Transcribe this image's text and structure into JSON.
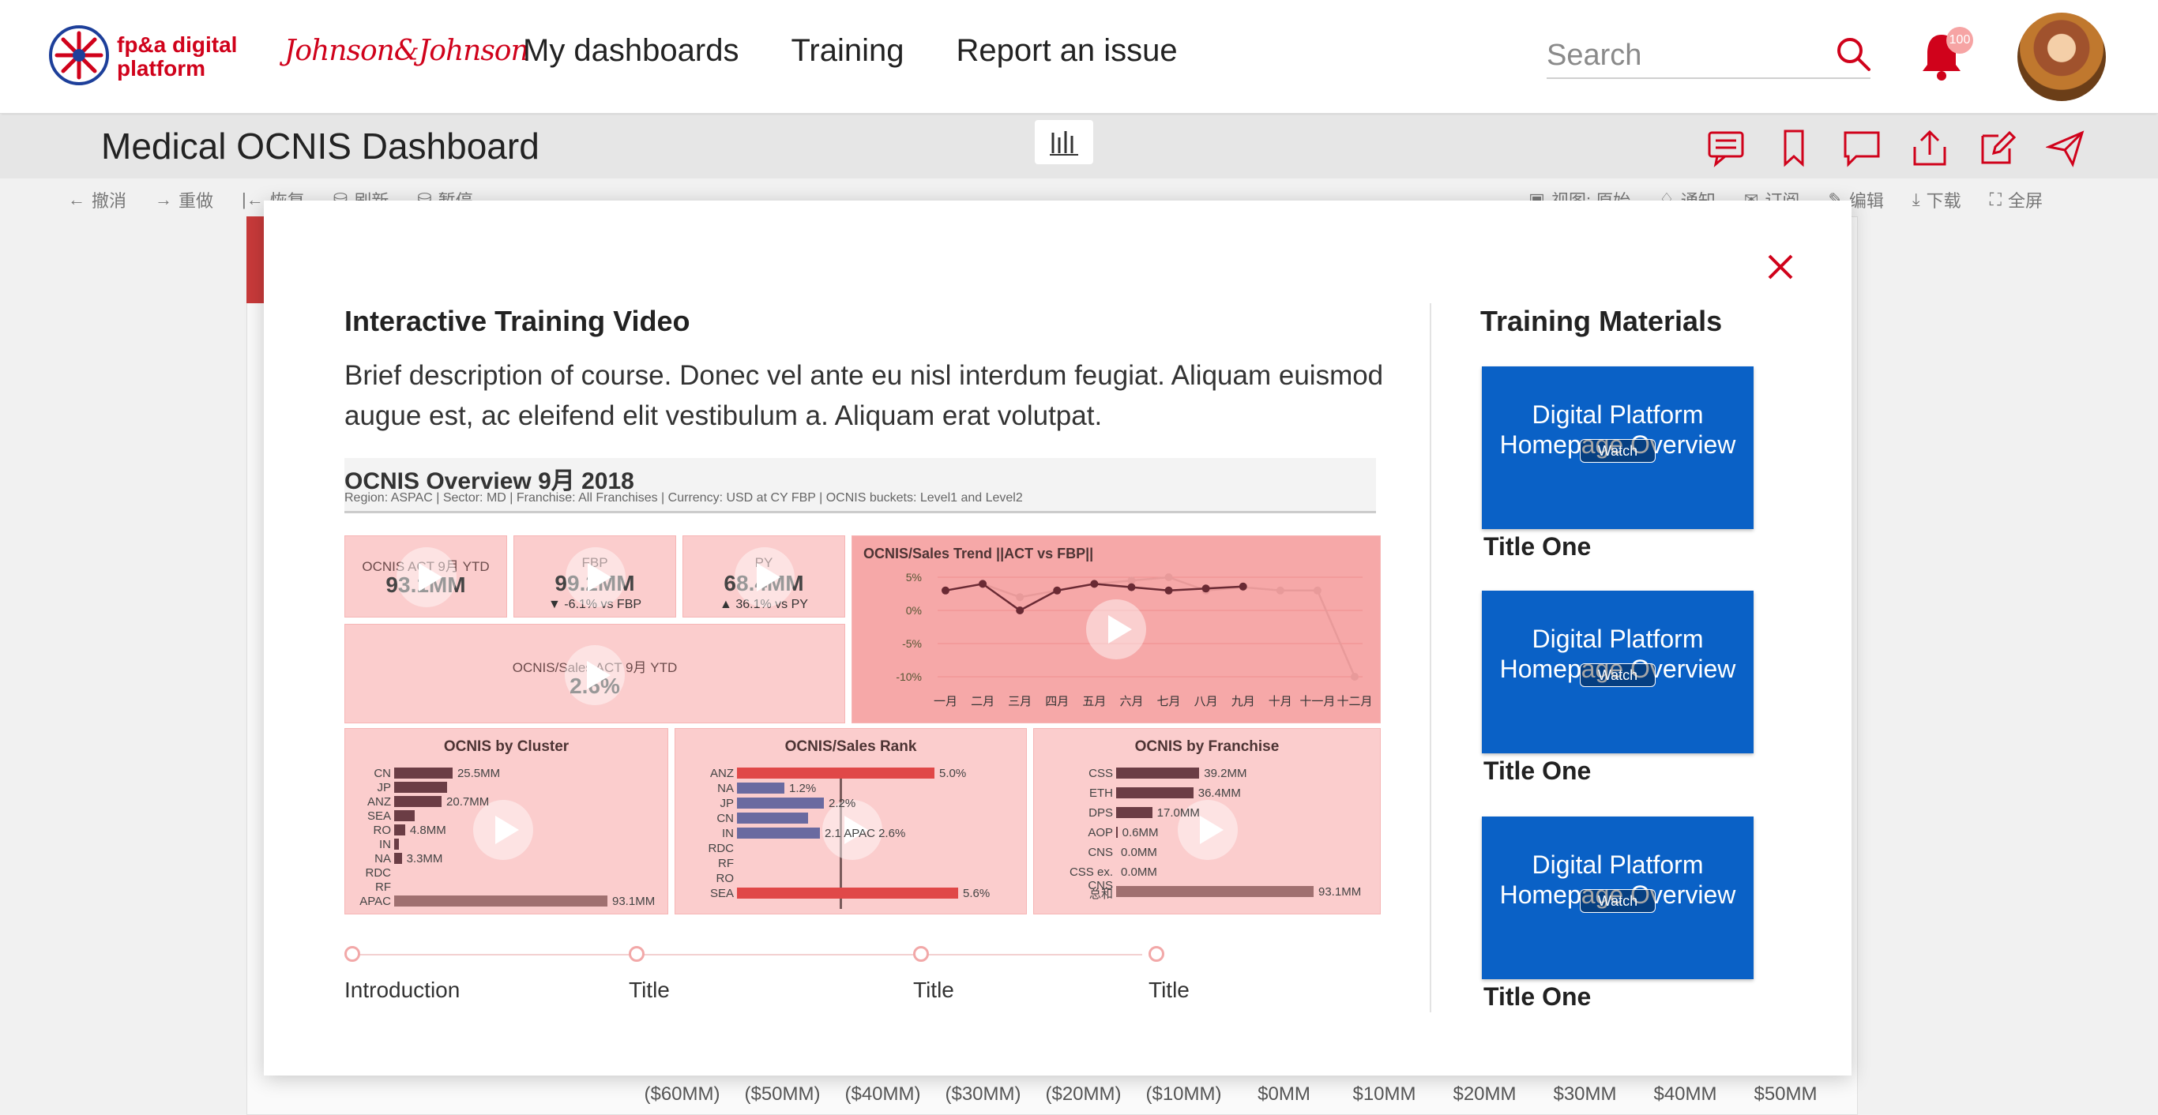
{
  "brand": {
    "name": "fp&a digital platform",
    "partner": "Johnson&Johnson"
  },
  "nav": {
    "links": [
      "My dashboards",
      "Training",
      "Report an issue"
    ]
  },
  "search": {
    "placeholder": "Search"
  },
  "notifications": {
    "count": "100"
  },
  "subheader": {
    "title": "Medical OCNIS Dashboard"
  },
  "toolbar": {
    "left": [
      "撤消",
      "重做",
      "恢复",
      "刷新",
      "暂停"
    ],
    "right": [
      "视图: 原始",
      "通知",
      "订阅",
      "编辑",
      "下载",
      "全屏"
    ]
  },
  "background": {
    "axis_labels": [
      "($60MM)",
      "($50MM)",
      "($40MM)",
      "($30MM)",
      "($20MM)",
      "($10MM)",
      "$0MM",
      "$10MM",
      "$20MM",
      "$30MM",
      "$40MM",
      "$50MM"
    ]
  },
  "modal": {
    "video_title": "Interactive Training Video",
    "description": "Brief description of course. Donec vel ante eu nisl interdum feugiat. Aliquam euismod augue est, ac eleifend elit vestibulum a. Aliquam erat volutpat.",
    "materials_title": "Training Materials",
    "timeline": [
      "Introduction",
      "Title",
      "Title",
      "Title"
    ],
    "materials": [
      {
        "thumb_text": "Digital Platform Homepage Overview",
        "watch": "Watch",
        "caption": "Title One"
      },
      {
        "thumb_text": "Digital Platform Homepage Overview",
        "watch": "Watch",
        "caption": "Title One"
      },
      {
        "thumb_text": "Digital Platform Homepage Overview",
        "watch": "Watch",
        "caption": "Title One"
      }
    ]
  },
  "video_preview": {
    "title": "OCNIS Overview 9月 2018",
    "subtitle": "Region: ASPAC | Sector: MD | Franchise: All Franchises | Currency: USD at CY FBP | OCNIS buckets: Level1 and Level2",
    "kpi": {
      "act_label": "OCNIS ACT 9月 YTD",
      "act_value": "93.1MM",
      "fbp_label": "FBP",
      "fbp_value": "99.2MM",
      "fbp_delta": "▼ -6.1% vs FBP",
      "py_label": "PY",
      "py_value": "68.4MM",
      "py_delta": "▲ 36.1% vs PY",
      "ratio_label": "OCNIS/Sales ACT 9月 YTD",
      "ratio_value": "2.6%"
    },
    "trend": {
      "title": "OCNIS/Sales Trend ||ACT vs FBP||",
      "months": [
        "一月",
        "二月",
        "三月",
        "四月",
        "五月",
        "六月",
        "七月",
        "八月",
        "九月",
        "十月",
        "十一月",
        "十二月"
      ],
      "act": [
        3,
        4,
        0,
        3,
        4,
        3.5,
        3,
        3.3,
        3.6
      ],
      "fbp": [
        3,
        4,
        2,
        3,
        4,
        4.5,
        5,
        3,
        3.5,
        3,
        3,
        -10
      ],
      "ylabels": [
        "5%",
        "0%",
        "-5%",
        "-10%"
      ]
    },
    "cluster": {
      "title": "OCNIS by Cluster",
      "rows": [
        {
          "cat": "CN",
          "value": 25.5,
          "label": "25.5MM"
        },
        {
          "cat": "JP",
          "value": 23,
          "label": ""
        },
        {
          "cat": "ANZ",
          "value": 20.7,
          "label": "20.7MM"
        },
        {
          "cat": "SEA",
          "value": 9,
          "label": ""
        },
        {
          "cat": "RO",
          "value": 4.8,
          "label": "4.8MM"
        },
        {
          "cat": "IN",
          "value": 2,
          "label": ""
        },
        {
          "cat": "NA",
          "value": 3.3,
          "label": "3.3MM"
        },
        {
          "cat": "RDC",
          "value": 0,
          "label": ""
        },
        {
          "cat": "RF",
          "value": 0,
          "label": ""
        },
        {
          "cat": "APAC",
          "value": 93.1,
          "label": "93.1MM"
        }
      ]
    },
    "rank": {
      "title": "OCNIS/Sales Rank",
      "rows": [
        {
          "cat": "ANZ",
          "value": 5.0,
          "label": "5.0%"
        },
        {
          "cat": "NA",
          "value": 1.2,
          "label": "1.2%"
        },
        {
          "cat": "JP",
          "value": 2.2,
          "label": "2.2%"
        },
        {
          "cat": "CN",
          "value": 1.8,
          "label": ""
        },
        {
          "cat": "IN",
          "value": 2.1,
          "label": "2.1 APAC 2.6%"
        },
        {
          "cat": "RDC",
          "value": 0,
          "label": ""
        },
        {
          "cat": "RF",
          "value": 0,
          "label": ""
        },
        {
          "cat": "RO",
          "value": 0,
          "label": ""
        },
        {
          "cat": "SEA",
          "value": 5.6,
          "label": "5.6%"
        }
      ]
    },
    "franchise": {
      "title": "OCNIS by Franchise",
      "rows": [
        {
          "cat": "CSS",
          "value": 39.2,
          "label": "39.2MM"
        },
        {
          "cat": "ETH",
          "value": 36.4,
          "label": "36.4MM"
        },
        {
          "cat": "DPS",
          "value": 17.0,
          "label": "17.0MM"
        },
        {
          "cat": "AOP",
          "value": 0.6,
          "label": "0.6MM"
        },
        {
          "cat": "CNS",
          "value": 0.0,
          "label": "0.0MM"
        },
        {
          "cat": "CSS ex. CNS",
          "value": 0.0,
          "label": "0.0MM"
        },
        {
          "cat": "总和",
          "value": 93.1,
          "label": "93.1MM"
        }
      ]
    }
  },
  "colors": {
    "brand_red": "#d0021b",
    "material_blue": "#0a61c6",
    "tile_pink": "#fbcdcd"
  }
}
